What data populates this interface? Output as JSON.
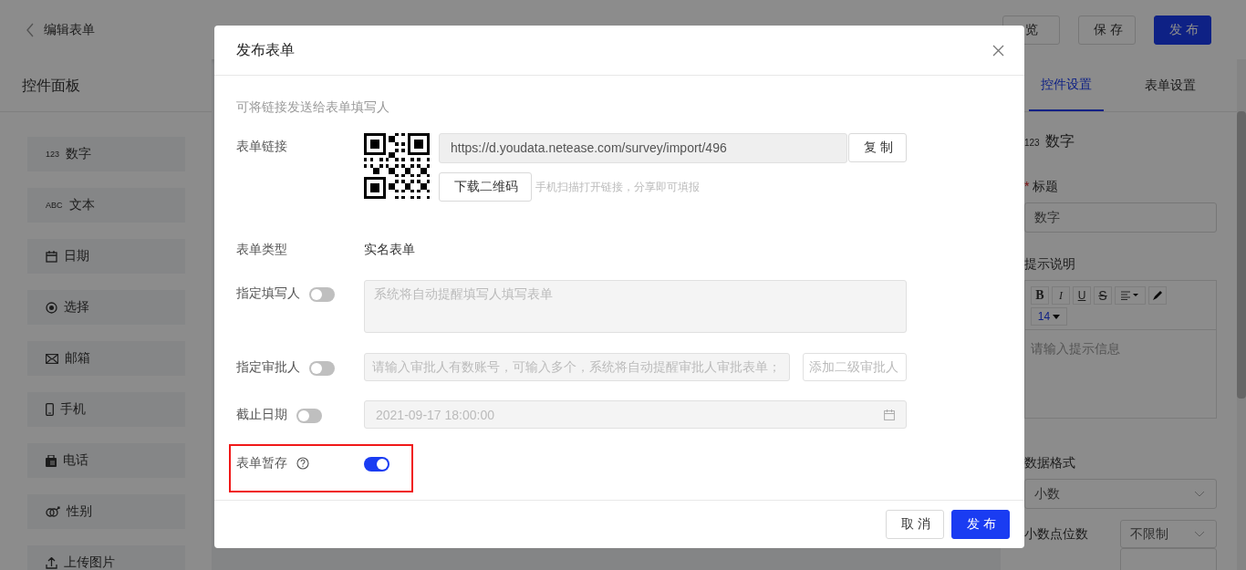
{
  "topbar": {
    "back_title": "编辑表单",
    "buttons": [
      {
        "label": "览",
        "kind": "outline"
      },
      {
        "label": "保 存",
        "kind": "outline"
      },
      {
        "label": "发 布",
        "kind": "primary"
      }
    ]
  },
  "left_panel": {
    "title": "控件面板",
    "items": [
      {
        "label": "数字",
        "icon_text": "123"
      },
      {
        "label": "文本",
        "icon_text": "ABC"
      },
      {
        "label": "日期"
      },
      {
        "label": "选择"
      },
      {
        "label": "邮箱"
      },
      {
        "label": "手机"
      },
      {
        "label": "电话"
      },
      {
        "label": "性别"
      },
      {
        "label": "上传图片"
      }
    ]
  },
  "right_panel": {
    "tabs": [
      {
        "label": "控件设置",
        "selected": true
      },
      {
        "label": "表单设置",
        "selected": false
      }
    ],
    "field_type": {
      "icon_text": "123",
      "label": "数字"
    },
    "title_field": {
      "label": "标题",
      "required_mark": "*",
      "value": "数字"
    },
    "hint": {
      "label": "提示说明",
      "toolbar": [
        {
          "label": "B",
          "kind": "bold"
        },
        {
          "label": "I",
          "kind": "italic"
        },
        {
          "label": "U",
          "kind": "underline"
        },
        {
          "label": "S",
          "kind": "strike"
        },
        {
          "kind": "align"
        },
        {
          "kind": "pen"
        }
      ],
      "font_size": "14",
      "placeholder": "请输入提示信息"
    },
    "data_format": {
      "label": "数据格式",
      "value": "小数"
    },
    "decimals": {
      "label": "小数点位数",
      "value": "不限制"
    }
  },
  "dialog": {
    "title": "发布表单",
    "intro": "可将链接发送给表单填写人",
    "link": {
      "label": "表单链接",
      "url": "https://d.youdata.netease.com/survey/import/496",
      "copy": "复 制",
      "download": "下载二维码",
      "hint": "手机扫描打开链接，分享即可填报"
    },
    "type": {
      "label": "表单类型",
      "value": "实名表单"
    },
    "settings": [
      {
        "kind": "textarea",
        "label": "指定填写人",
        "on": false,
        "placeholder": "系统将自动提醒填写人填写表单",
        "highlighted": false
      },
      {
        "kind": "pair",
        "label": "指定审批人",
        "on": false,
        "placeholder": "请输入审批人有数账号，可输入多个，系统将自动提醒审批人审批表单；",
        "second_placeholder": "添加二级审批人",
        "highlighted": false
      },
      {
        "kind": "date",
        "label": "截止日期",
        "on": false,
        "value": "2021-09-17 18:00:00",
        "highlighted": false
      },
      {
        "kind": "help",
        "label": "表单暂存",
        "on": true,
        "highlighted": true
      }
    ],
    "buttons": [
      {
        "label": "取 消",
        "kind": "outline"
      },
      {
        "label": "发 布",
        "kind": "primary"
      }
    ]
  }
}
